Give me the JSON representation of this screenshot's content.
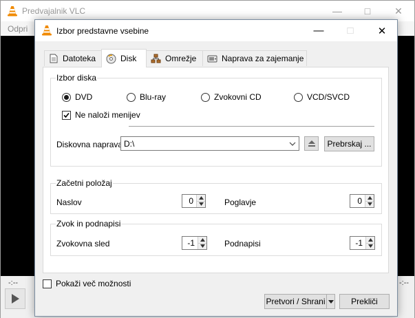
{
  "background_window": {
    "title": "Predvajalnik VLC",
    "menu_first": "Odpri",
    "time_left": "-:--",
    "time_right": "-:--"
  },
  "dialog": {
    "title": "Izbor predstavne vsebine",
    "tabs": [
      {
        "label": "Datoteka",
        "icon": "file-icon"
      },
      {
        "label": "Disk",
        "icon": "disc-icon",
        "active": true
      },
      {
        "label": "Omrežje",
        "icon": "network-icon"
      },
      {
        "label": "Naprava za zajemanje",
        "icon": "capture-device-icon"
      }
    ],
    "disc_selection": {
      "group_label": "Izbor diska",
      "options": [
        "DVD",
        "Blu-ray",
        "Zvokovni CD",
        "VCD/SVCD"
      ],
      "selected": "DVD",
      "no_menus_label": "Ne naloži menijev",
      "no_menus_checked": true,
      "device_label": "Diskovna naprava",
      "device_value": "D:\\",
      "browse_label": "Prebrskaj ..."
    },
    "start_position": {
      "group_label": "Začetni položaj",
      "title_label": "Naslov",
      "title_value": "0",
      "chapter_label": "Poglavje",
      "chapter_value": "0"
    },
    "audio_subtitles": {
      "group_label": "Zvok in podnapisi",
      "audio_label": "Zvokovna sled",
      "audio_value": "-1",
      "subtitles_label": "Podnapisi",
      "subtitles_value": "-1"
    },
    "show_more_label": "Pokaži več možnosti",
    "convert_label": "Pretvori / Shrani",
    "cancel_label": "Prekliči"
  },
  "colors": {
    "vlc_orange": "#f08a00",
    "video_black": "#000000"
  }
}
